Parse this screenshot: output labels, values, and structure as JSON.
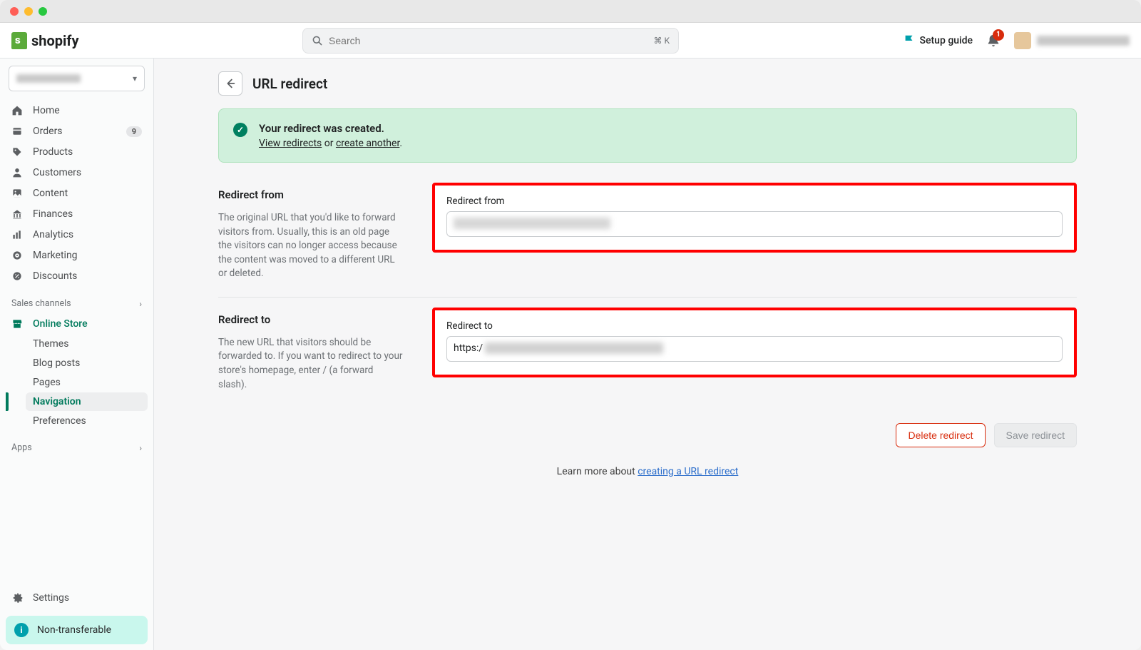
{
  "logo_text": "shopify",
  "search": {
    "placeholder": "Search",
    "shortcut": "⌘ K"
  },
  "setup_guide": "Setup guide",
  "notifications_count": "1",
  "sidebar": {
    "items": [
      {
        "label": "Home"
      },
      {
        "label": "Orders",
        "badge": "9"
      },
      {
        "label": "Products"
      },
      {
        "label": "Customers"
      },
      {
        "label": "Content"
      },
      {
        "label": "Finances"
      },
      {
        "label": "Analytics"
      },
      {
        "label": "Marketing"
      },
      {
        "label": "Discounts"
      }
    ],
    "sales_channels": "Sales channels",
    "online_store": "Online Store",
    "sub": {
      "themes": "Themes",
      "blog": "Blog posts",
      "pages": "Pages",
      "navigation": "Navigation",
      "preferences": "Preferences"
    },
    "apps": "Apps",
    "settings": "Settings",
    "nontransferable": "Non-transferable"
  },
  "page": {
    "title": "URL redirect",
    "banner_title": "Your redirect was created.",
    "banner_view": "View redirects",
    "banner_or": " or ",
    "banner_create": "create another",
    "banner_period": ".",
    "redirect_from_title": "Redirect from",
    "redirect_from_desc": "The original URL that you'd like to forward visitors from. Usually, this is an old page the visitors can no longer access because the content was moved to a different URL or deleted.",
    "redirect_from_label": "Redirect from",
    "redirect_to_title": "Redirect to",
    "redirect_to_desc": "The new URL that visitors should be forwarded to. If you want to redirect to your store's homepage, enter / (a forward slash).",
    "redirect_to_label": "Redirect to",
    "redirect_to_prefix": "https:/",
    "delete_btn": "Delete redirect",
    "save_btn": "Save redirect",
    "learn_prefix": "Learn more about ",
    "learn_link": "creating a URL redirect"
  }
}
